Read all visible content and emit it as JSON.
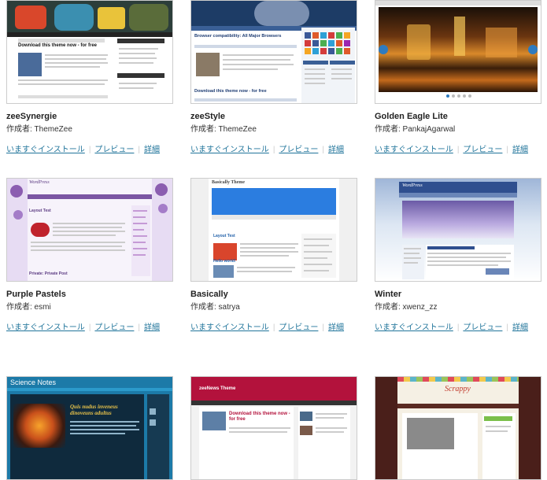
{
  "link_labels": {
    "install": "いますぐインストール",
    "preview": "プレビュー",
    "details": "詳細"
  },
  "themes": [
    {
      "name": "zeeSynergie",
      "author": "作成者: ThemeZee",
      "thumb_headline": "Download this theme now - for free"
    },
    {
      "name": "zeeStyle",
      "author": "作成者: ThemeZee",
      "thumb_headline": "Browser compatibility: All Major Browsers",
      "thumb_headline2": "Download this theme now - for free"
    },
    {
      "name": "Golden Eagle Lite",
      "author": "作成者: PankajAgarwal"
    },
    {
      "name": "Purple Pastels",
      "author": "作成者: esmi",
      "thumb_site": "WordPress",
      "thumb_post": "Layout Test",
      "thumb_post2": "Private: Private Post"
    },
    {
      "name": "Basically",
      "author": "作成者: satrya",
      "thumb_site": "Basically Theme",
      "thumb_post": "Layout Test",
      "thumb_post2": "Hello world!"
    },
    {
      "name": "Winter",
      "author": "作成者: xwenz_zz",
      "thumb_site": "WordPress"
    },
    {
      "thumb_site": "Science Notes",
      "thumb_quote": "Quis nudus inveneus dinoveuns adultus"
    },
    {
      "thumb_site": "zeeNews Theme",
      "thumb_headline": "Download this theme now - for free"
    },
    {
      "thumb_site": "Scrappy"
    }
  ]
}
